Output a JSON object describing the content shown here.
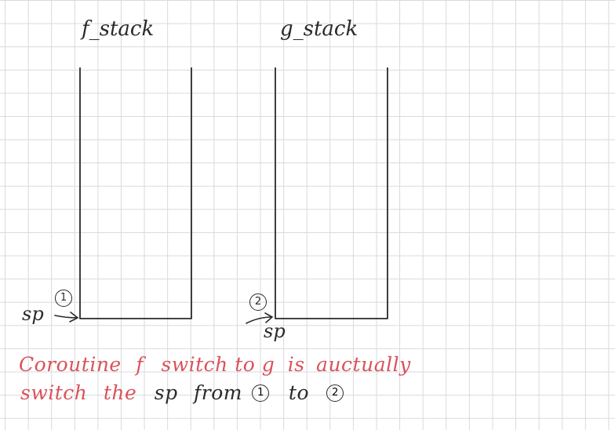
{
  "stacks": {
    "f_label": "f_stack",
    "g_label": "g_stack"
  },
  "pointers": {
    "sp_left_label": "sp",
    "sp_right_label": "sp",
    "marker_1": "1",
    "marker_2": "2"
  },
  "note": {
    "line1": {
      "w1": "Coroutine",
      "w2": "f",
      "w3": "switch",
      "w4": "to",
      "w5": "g",
      "w6": "is",
      "w7": "auctually"
    },
    "line2": {
      "w1": "switch",
      "w2": "the",
      "w3": "sp",
      "w4": "from",
      "c1": "1",
      "w5": "to",
      "c2": "2"
    }
  },
  "colors": {
    "ink": "#2a2a2a",
    "red_ink": "#d9535a",
    "grid": "#d7d9df"
  }
}
